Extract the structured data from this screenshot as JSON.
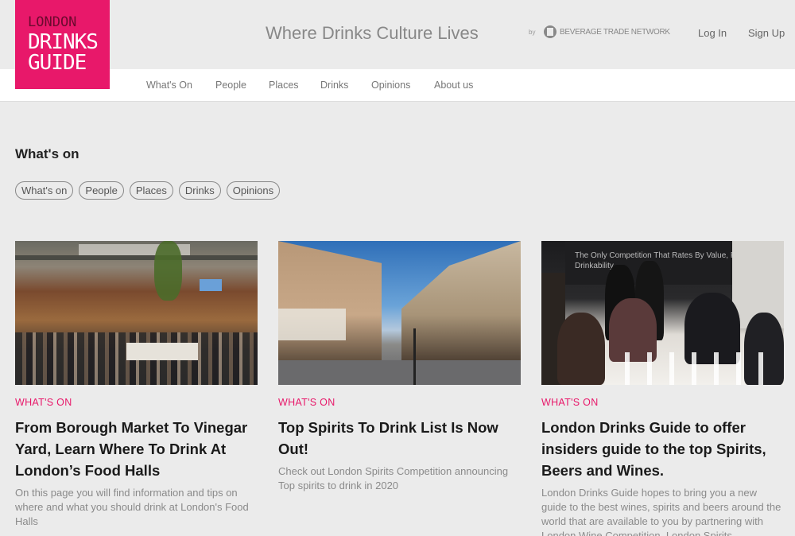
{
  "header": {
    "logo_line1": "LONDON",
    "logo_line2": "DRINKS",
    "logo_line3": "GUIDE",
    "tagline": "Where Drinks Culture Lives",
    "by_label": "by",
    "partner_name": "BEVERAGE TRADE NETWORK",
    "login": "Log In",
    "signup": "Sign Up"
  },
  "nav": {
    "items": [
      "What's On",
      "People",
      "Places",
      "Drinks",
      "Opinions",
      "About us"
    ]
  },
  "section": {
    "title": "What's on",
    "chips": [
      "What's on",
      "People",
      "Places",
      "Drinks",
      "Opinions"
    ]
  },
  "cards": [
    {
      "category": "WHAT'S ON",
      "title": "From Borough Market To Vinegar Yard, Learn Where To Drink At London’s Food Halls",
      "description": "On this page you will find information and tips on where and what you should drink at London's Food Halls"
    },
    {
      "category": "WHAT'S ON",
      "title": "Top Spirits To Drink List Is Now Out!",
      "description": "Check out London Spirits Competition announcing Top spirits to drink in 2020"
    },
    {
      "category": "WHAT'S ON",
      "title": "London Drinks Guide to offer insiders guide to the top Spirits, Beers and Wines.",
      "description": "London Drinks Guide hopes to bring you a new guide to the best wines, spirits and beers around the world that are available to you by partnering with London Wine Competition, London Spirits"
    }
  ],
  "card3_banner_text": "The Only Competition That Rates By Value, Package & Drinkability",
  "colors": {
    "brand": "#e8186a",
    "background": "#ebebeb"
  }
}
